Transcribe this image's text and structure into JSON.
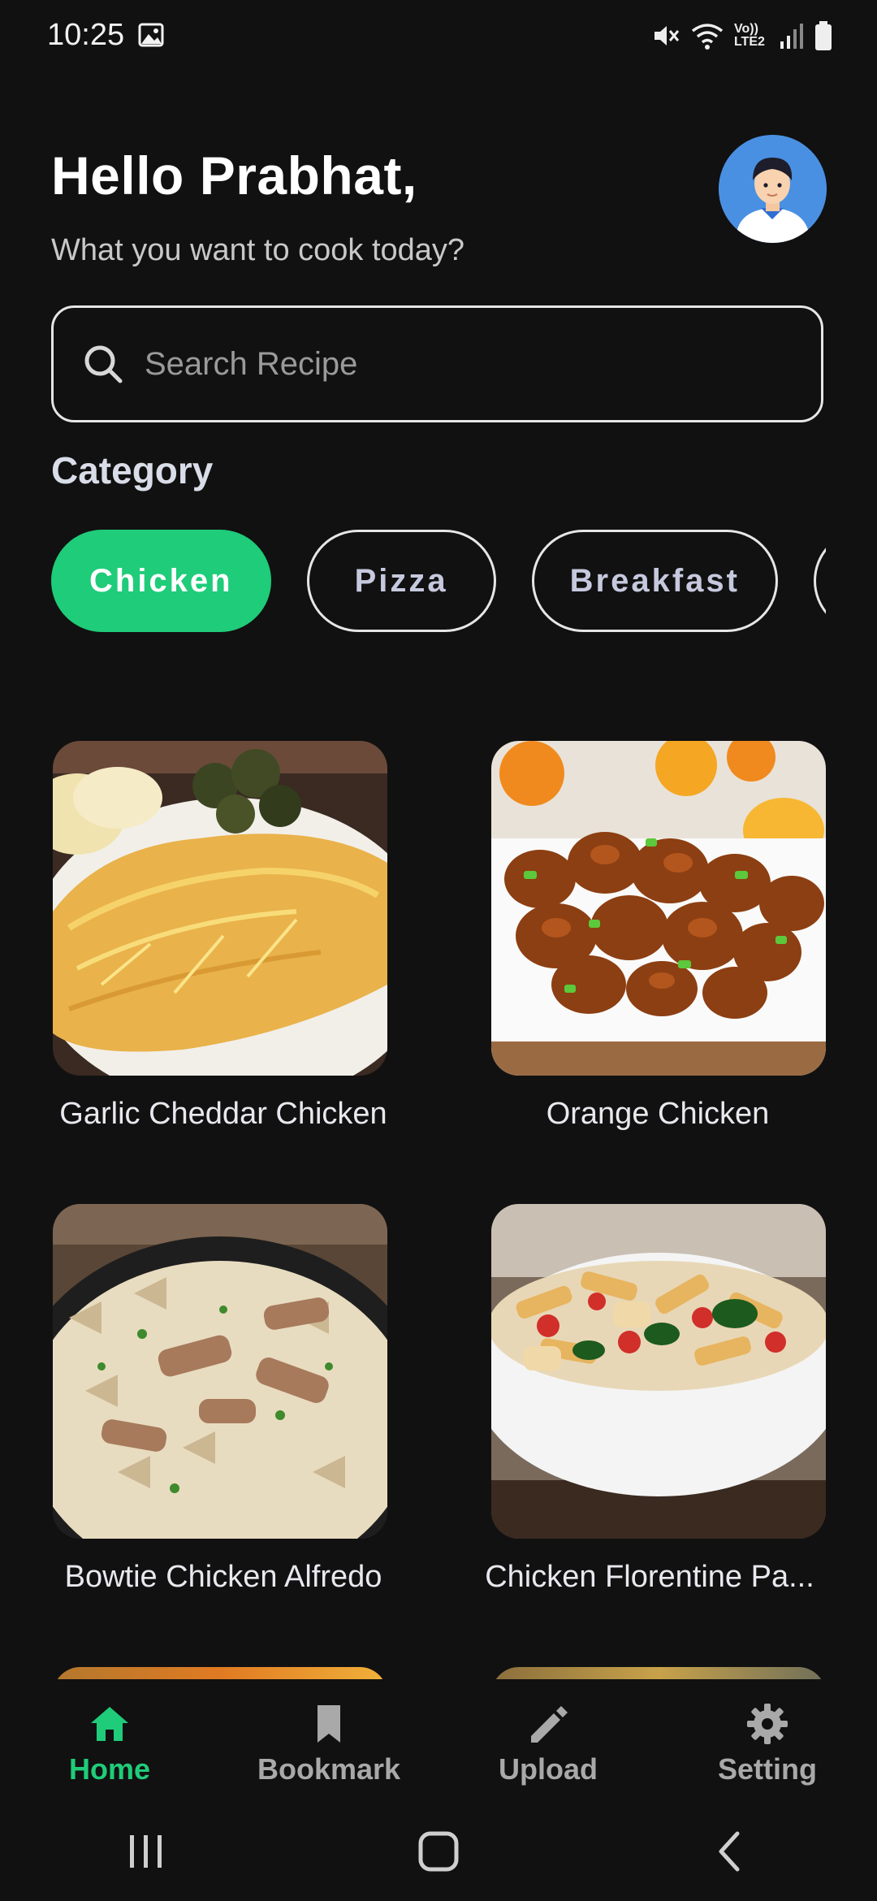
{
  "status_bar": {
    "time": "10:25",
    "network_label": "Vo)) LTE2",
    "icons": [
      "gallery-icon",
      "mute-icon",
      "wifi-icon",
      "signal-icon",
      "battery-icon"
    ]
  },
  "header": {
    "greeting": "Hello Prabhat,",
    "subtitle": "What you want to cook today?",
    "avatar": "user-avatar-icon"
  },
  "search": {
    "placeholder": "Search Recipe",
    "value": "",
    "icon": "search-icon"
  },
  "category": {
    "title": "Category",
    "chips": [
      {
        "label": "Chicken",
        "active": true
      },
      {
        "label": "Pizza",
        "active": false
      },
      {
        "label": "Breakfast",
        "active": false
      },
      {
        "label": "",
        "active": false
      }
    ]
  },
  "recipes": [
    {
      "title": "Garlic Cheddar Chicken"
    },
    {
      "title": "Orange Chicken"
    },
    {
      "title": "Bowtie Chicken Alfredo"
    },
    {
      "title": "Chicken Florentine Pa..."
    }
  ],
  "bottom_nav": {
    "items": [
      {
        "label": "Home",
        "icon": "home-icon",
        "active": true
      },
      {
        "label": "Bookmark",
        "icon": "bookmark-icon",
        "active": false
      },
      {
        "label": "Upload",
        "icon": "pencil-icon",
        "active": false
      },
      {
        "label": "Setting",
        "icon": "gear-icon",
        "active": false
      }
    ]
  },
  "colors": {
    "background": "#111111",
    "accent": "#1fcc79",
    "text_primary": "#ffffff",
    "text_secondary": "#c8c8c8",
    "nav_inactive": "#a9a9a9"
  }
}
